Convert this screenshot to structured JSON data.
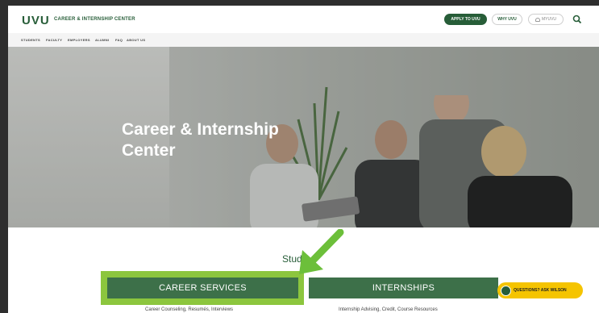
{
  "header": {
    "logo": "UVU",
    "site_title": "CAREER & INTERNSHIP CENTER",
    "apply_label": "APPLY TO UVU",
    "why_label": "WHY UVU",
    "myuvu_label": "MYUVU"
  },
  "nav": {
    "items": [
      "STUDENTS",
      "FACULTY",
      "EMPLOYERS",
      "ALUMNI",
      "FAQ",
      "ABOUT US"
    ]
  },
  "hero": {
    "title_line1": "Career & Internship",
    "title_line2": "Center"
  },
  "section": {
    "heading": "Stude",
    "career_label": "CAREER SERVICES",
    "internships_label": "INTERNSHIPS",
    "career_sub": "Career Counseling, Resumés, Interviews",
    "internships_sub": "Internship Advising, Credit, Course Resources"
  },
  "chat": {
    "label": "QUESTIONS? ASK WILSON"
  },
  "colors": {
    "brand_green": "#275d38",
    "highlight_green": "#8cc63e",
    "arrow_green": "#6cbf3a",
    "chat_yellow": "#f5c400"
  }
}
